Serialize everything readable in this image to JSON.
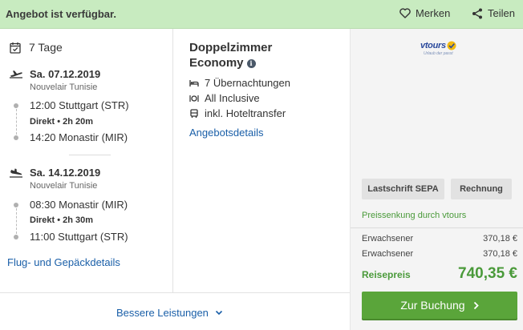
{
  "topbar": {
    "status": "Angebot ist verfügbar.",
    "merken": "Merken",
    "teilen": "Teilen"
  },
  "flight": {
    "duration": "7 Tage",
    "outbound": {
      "date": "Sa. 07.12.2019",
      "airline": "Nouvelair Tunisie",
      "dep": "12:00 Stuttgart (STR)",
      "info": "Direkt  •  2h 20m",
      "arr": "14:20 Monastir (MIR)"
    },
    "return": {
      "date": "Sa. 14.12.2019",
      "airline": "Nouvelair Tunisie",
      "dep": "08:30 Monastir (MIR)",
      "info": "Direkt  •  2h 30m",
      "arr": "11:00 Stuttgart (STR)"
    },
    "details_link": "Flug- und Gepäckdetails"
  },
  "hotel": {
    "room_line1": "Doppelzimmer",
    "room_line2": "Economy",
    "info_glyph": "i",
    "features": [
      "7 Übernachtungen",
      "All Inclusive",
      "inkl. Hoteltransfer"
    ],
    "details_link": "Angebotsdetails"
  },
  "offer": {
    "logo_text": "vtours",
    "payments": [
      "Lastschrift SEPA",
      "Rechnung"
    ],
    "promo": "Preissenkung durch vtours",
    "persons": [
      {
        "label": "Erwachsener",
        "price": "370,18 €"
      },
      {
        "label": "Erwachsener",
        "price": "370,18 €"
      }
    ],
    "total_label": "Reisepreis",
    "total_price": "740,35 €",
    "book_label": "Zur Buchung"
  },
  "footer": {
    "better_label": "Bessere Leistungen"
  },
  "colors": {
    "status_bg": "#c8ebc0",
    "accent_green": "#5aa53a",
    "link_blue": "#1a5fa8",
    "price_green": "#4a9a3a"
  }
}
